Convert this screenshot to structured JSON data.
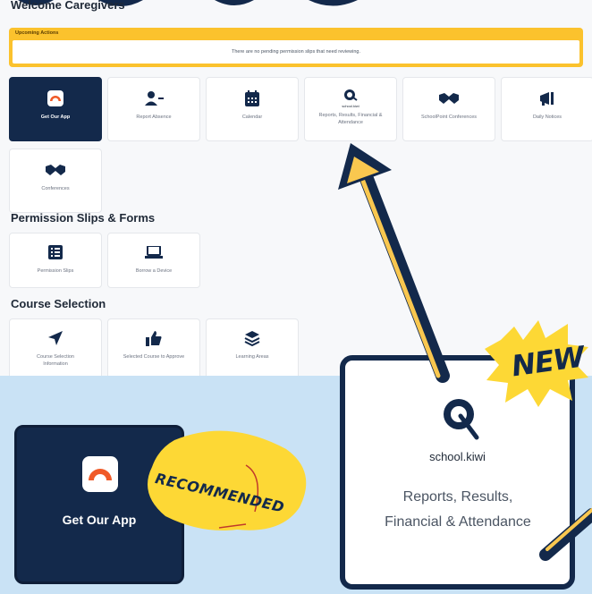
{
  "header": {
    "welcome": "Welcome Caregivers"
  },
  "upcoming": {
    "title": "Upcoming Actions",
    "message": "There are no pending permission slips that need reviewing."
  },
  "tiles": {
    "get_app": "Get Our App",
    "report_absence": "Report Absence",
    "calendar": "Calendar",
    "reports": "Reports, Results, Financial & Attendance",
    "reports_brand": "school.kiwi",
    "schoolpoint": "SchoolPoint Conferences",
    "daily_notices": "Daily Notices",
    "conferences": "Conferences",
    "permission_slips": "Permission Slips",
    "borrow_device": "Borrow a Device",
    "course_info": "Course Selection Information",
    "selected_course": "Selected Course to Approve",
    "learning_areas": "Learning Areas"
  },
  "sections": {
    "permission": "Permission Slips & Forms",
    "course": "Course Selection"
  },
  "callouts": {
    "app_label": "Get Our App",
    "recommended": "RECOMMENDED",
    "new": "NEW",
    "zoom_brand": "school.kiwi",
    "zoom_label": "Reports, Results, Financial & Attendance"
  },
  "colors": {
    "navy": "#13294b",
    "yellow": "#fbc22d",
    "light_blue": "#c9e2f5"
  }
}
